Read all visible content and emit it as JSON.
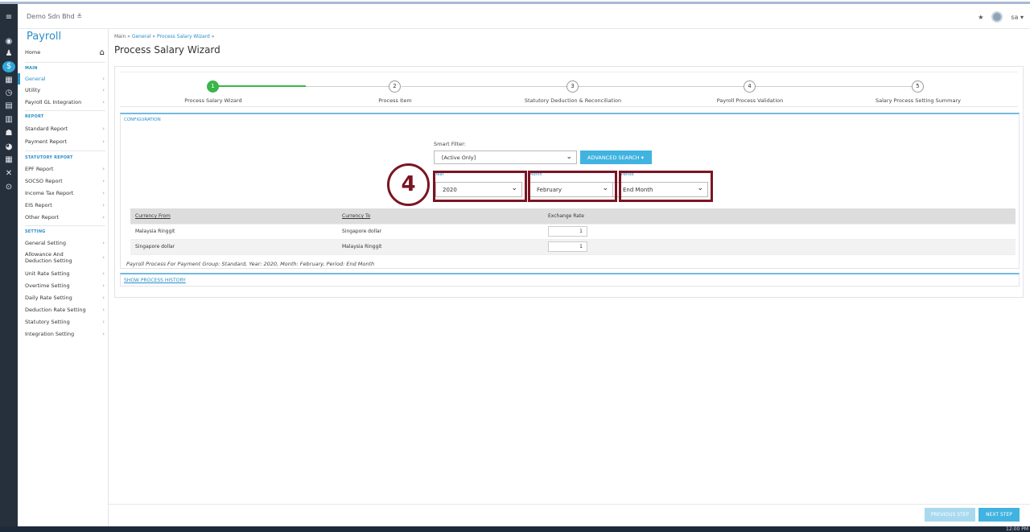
{
  "topbar": {
    "company": "Demo Sdn Bhd",
    "company_caret": "≡",
    "user": "sa"
  },
  "sidebar": {
    "title": "Payroll",
    "home": "Home",
    "sections": {
      "main": "MAIN",
      "report": "REPORT",
      "statutory": "STATUTORY REPORT",
      "setting": "SETTING"
    },
    "main_items": [
      "General",
      "Utility",
      "Payroll GL Integration"
    ],
    "report_items": [
      "Standard Report",
      "Payment Report"
    ],
    "statutory_items": [
      "EPF Report",
      "SOCSO Report",
      "Income Tax Report",
      "EIS Report",
      "Other Report"
    ],
    "setting_items": [
      "General Setting",
      "Allowance And Deduction Setting",
      "Unit Rate Setting",
      "Overtime Setting",
      "Daily Rate Setting",
      "Deduction Rate Setting",
      "Statutory Setting",
      "Integration Setting"
    ]
  },
  "breadcrumb": {
    "main": "Main",
    "general": "General",
    "wizard": "Process Salary Wizard"
  },
  "page_title": "Process Salary Wizard",
  "wizard": {
    "steps": [
      {
        "num": "1",
        "label": "Process Salary Wizard"
      },
      {
        "num": "2",
        "label": "Process Item"
      },
      {
        "num": "3",
        "label": "Statutory Deduction & Reconciliation"
      },
      {
        "num": "4",
        "label": "Payroll Process Validation"
      },
      {
        "num": "5",
        "label": "Salary Process Setting Summary"
      }
    ],
    "active_step": 1
  },
  "config": {
    "heading": "CONFIGURATION",
    "smart_filter_label": "Smart Filter:",
    "smart_filter_value": "[Active Only]",
    "advanced_search": "ADVANCED SEARCH",
    "year_label": "Year",
    "year_value": "2020",
    "month_label": "Month",
    "month_value": "February",
    "period_label": "Period",
    "period_value": "End Month",
    "callout": "4"
  },
  "rates": {
    "headers": [
      "Currency From",
      "Currency To",
      "Exchange Rate"
    ],
    "rows": [
      {
        "from": "Malaysia Ringgit",
        "to": "Singapore dollar",
        "rate": "1"
      },
      {
        "from": "Singapore dollar",
        "to": "Malaysia Ringgit",
        "rate": "1"
      }
    ]
  },
  "note": "Payroll Process For Payment Group: Standard, Year: 2020, Month: February, Period: End Month",
  "history_link": "SHOW PROCESS HISTORY",
  "footer": {
    "previous": "PREVIOUS STEP",
    "next": "NEXT STEP"
  },
  "taskbar": {
    "clock": "12:00 PM"
  },
  "colors": {
    "accent": "#2a8fc7",
    "step_done": "#3ab54a",
    "highlight": "#7a1523",
    "button": "#41b3e0"
  }
}
